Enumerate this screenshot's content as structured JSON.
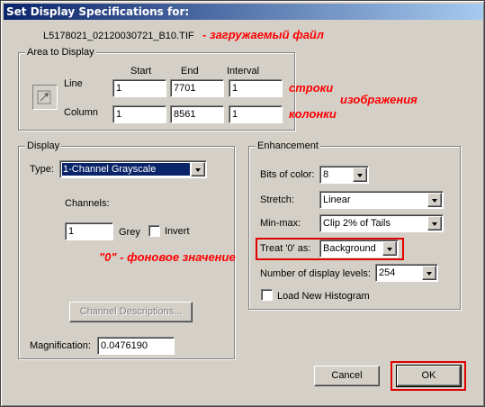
{
  "dialog": {
    "title": "Set Display Specifications for:",
    "filename": "L5178021_02120030721_B10.TIF"
  },
  "area": {
    "group_label": "Area to Display",
    "col_start": "Start",
    "col_end": "End",
    "col_interval": "Interval",
    "line_label": "Line",
    "column_label": "Column",
    "line_start": "1",
    "line_end": "7701",
    "line_interval": "1",
    "column_start": "1",
    "column_end": "8561",
    "column_interval": "1"
  },
  "display": {
    "group_label": "Display",
    "type_label": "Type:",
    "type_value": "1-Channel Grayscale",
    "channels_label": "Channels:",
    "channel_value": "1",
    "grey_label": "Grey",
    "invert_label": "Invert",
    "invert_checked": false,
    "channel_desc_button": "Channel Descriptions...",
    "magnification_label": "Magnification:",
    "magnification_value": "0.0476190"
  },
  "enhancement": {
    "group_label": "Enhancement",
    "bits_label": "Bits of color:",
    "bits_value": "8",
    "stretch_label": "Stretch:",
    "stretch_value": "Linear",
    "minmax_label": "Min-max:",
    "minmax_value": "Clip 2% of Tails",
    "treat_label": "Treat '0' as:",
    "treat_value": "Background",
    "levels_label": "Number of display levels:",
    "levels_value": "254",
    "new_histogram_label": "Load New Histogram",
    "new_histogram_checked": false
  },
  "buttons": {
    "cancel": "Cancel",
    "ok": "OK"
  },
  "annotations": {
    "file": "- загружаемый файл",
    "rows": "строки",
    "image": "изображения",
    "columns": "колонки",
    "zero": "\"0\" - фоновое значение",
    "color": "#ff0000"
  }
}
